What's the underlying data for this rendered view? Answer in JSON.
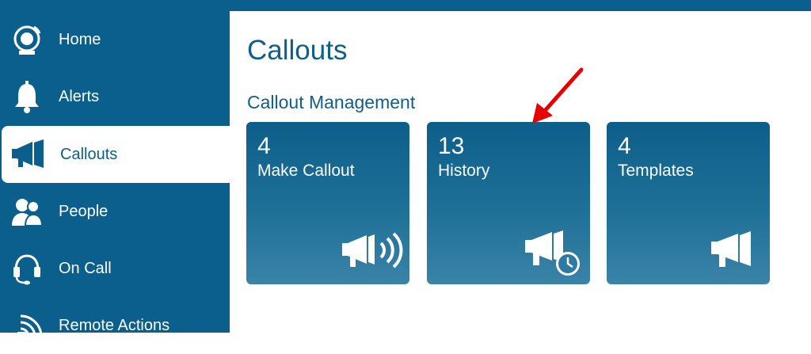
{
  "sidebar": {
    "items": [
      {
        "label": "Home",
        "icon": "home-bell-icon"
      },
      {
        "label": "Alerts",
        "icon": "bell-icon"
      },
      {
        "label": "Callouts",
        "icon": "megaphone-icon",
        "active": true
      },
      {
        "label": "People",
        "icon": "people-icon"
      },
      {
        "label": "On Call",
        "icon": "headset-icon"
      },
      {
        "label": "Remote Actions",
        "icon": "signal-icon"
      }
    ]
  },
  "main": {
    "title": "Callouts",
    "section_title": "Callout Management",
    "tiles": [
      {
        "count": "4",
        "label": "Make Callout",
        "icon": "megaphone-sound-icon"
      },
      {
        "count": "13",
        "label": "History",
        "icon": "megaphone-clock-icon"
      },
      {
        "count": "4",
        "label": "Templates",
        "icon": "megaphone-icon"
      }
    ]
  },
  "colors": {
    "sidebar": "#0a5f8c",
    "tile_top": "#0d5f8b",
    "tile_bottom": "#3a83a8",
    "heading": "#0f5e8b",
    "arrow": "#e60000"
  }
}
